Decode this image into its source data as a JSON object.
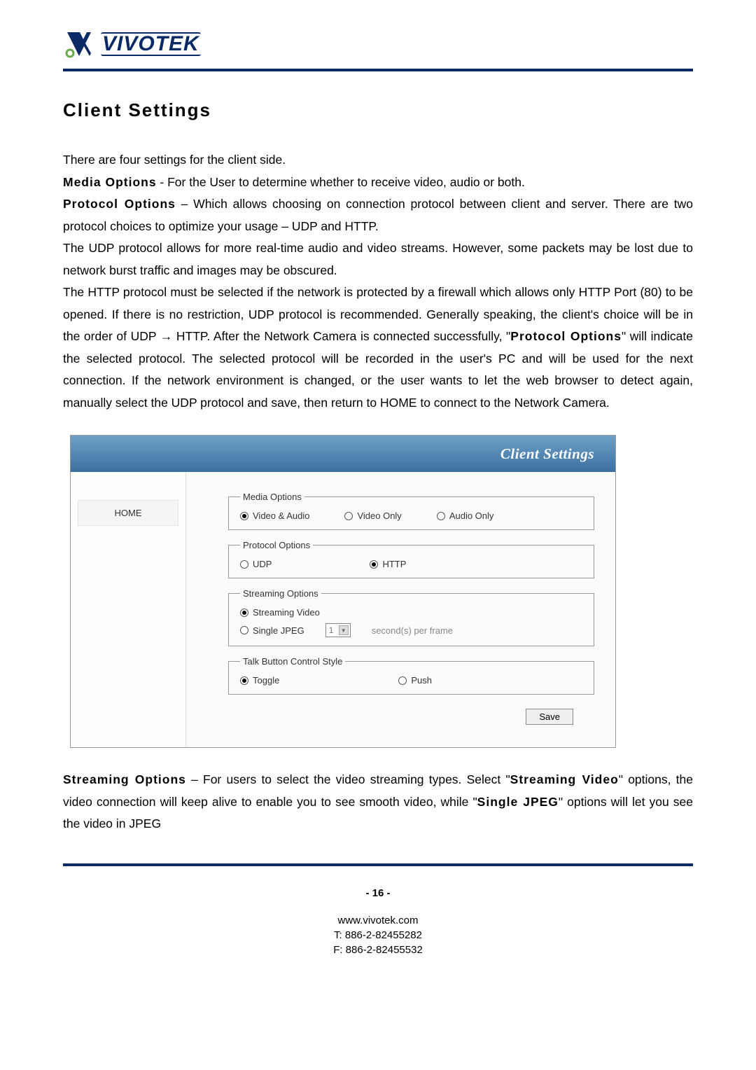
{
  "brand": {
    "name": "VIVOTEK"
  },
  "heading": "Client Settings",
  "intro": "There are four settings for the client side.",
  "media_label": "Media Options",
  "media_desc": " - For the User to determine whether to receive video, audio or both.",
  "protocol_label": "Protocol Options",
  "protocol_desc": " – Which allows choosing on connection protocol between client and server. There are two protocol choices to optimize your usage – UDP and HTTP.",
  "udp_para": "The UDP protocol allows for more real-time audio and video streams. However, some packets may be lost due to network burst traffic and images may be obscured.",
  "http_para_1": "The HTTP protocol must be selected if the network is protected by a firewall which allows only HTTP Port (80) to be opened. If there is no restriction, UDP protocol is recommended. Generally speaking, the client's choice will be in the order of UDP → HTTP. After the Network Camera is connected successfully, \"",
  "http_para_bold": "Protocol Options",
  "http_para_2": "\" will indicate the selected protocol. The selected protocol will be recorded in the user's PC and will be used for the next connection. If the network environment is changed, or the user wants to let the web browser to detect again, manually select the UDP protocol and save, then return to HOME to connect to the Network Camera.",
  "screenshot": {
    "title": "Client Settings",
    "sidebar": {
      "home": "HOME"
    },
    "groups": {
      "media": {
        "legend": "Media Options",
        "opt1": "Video & Audio",
        "opt2": "Video Only",
        "opt3": "Audio Only"
      },
      "protocol": {
        "legend": "Protocol Options",
        "opt1": "UDP",
        "opt2": "HTTP"
      },
      "streaming": {
        "legend": "Streaming Options",
        "opt1": "Streaming Video",
        "opt2": "Single JPEG",
        "select_value": "1",
        "per_frame": "second(s) per frame"
      },
      "talk": {
        "legend": "Talk Button Control Style",
        "opt1": "Toggle",
        "opt2": "Push"
      }
    },
    "save": "Save"
  },
  "streaming_label": "Streaming Options",
  "streaming_desc_1": " – For users to select the video streaming types. Select \"",
  "streaming_bold": "Streaming Video",
  "streaming_desc_2": "\" options, the video connection will keep alive to enable you to see smooth video, while \"",
  "streaming_bold2": "Single JPEG",
  "streaming_desc_3": "\" options will let you see the video in JPEG",
  "footer": {
    "page": "- 16 -",
    "url": "www.vivotek.com",
    "tel": "T: 886-2-82455282",
    "fax": "F: 886-2-82455532"
  }
}
